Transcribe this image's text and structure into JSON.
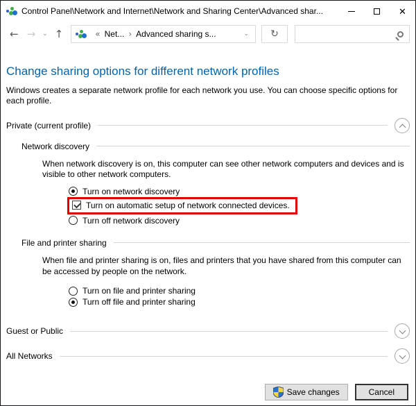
{
  "colors": {
    "heading": "#0063B1",
    "highlight": "#E00000"
  },
  "titlebar": {
    "title": "Control Panel\\Network and Internet\\Network and Sharing Center\\Advanced shar..."
  },
  "navbar": {
    "back": "←",
    "forward": "→",
    "history_dropdown": "⌄",
    "up": "↑",
    "crumb_overflow": "«",
    "crumb1": "Net...",
    "crumb_sep": "›",
    "crumb2": "Advanced sharing s...",
    "address_dropdown": "⌄",
    "refresh": "↻",
    "search_value": "",
    "search_placeholder": ""
  },
  "page": {
    "heading": "Change sharing options for different network profiles",
    "intro": "Windows creates a separate network profile for each network you use. You can choose specific options for each profile."
  },
  "private_section": {
    "label": "Private (current profile)",
    "expanded": true,
    "network_discovery": {
      "label": "Network discovery",
      "description": "When network discovery is on, this computer can see other network computers and devices and is visible to other network computers.",
      "turn_on": "Turn on network discovery",
      "turn_on_selected": true,
      "auto_setup": "Turn on automatic setup of network connected devices.",
      "auto_setup_checked": true,
      "turn_off": "Turn off network discovery",
      "turn_off_selected": false
    },
    "file_printer_sharing": {
      "label": "File and printer sharing",
      "description": "When file and printer sharing is on, files and printers that you have shared from this computer can be accessed by people on the network.",
      "turn_on": "Turn on file and printer sharing",
      "turn_on_selected": false,
      "turn_off": "Turn off file and printer sharing",
      "turn_off_selected": true
    }
  },
  "guest_section": {
    "label": "Guest or Public",
    "expanded": false
  },
  "all_networks_section": {
    "label": "All Networks",
    "expanded": false
  },
  "footer": {
    "save": "Save changes",
    "cancel": "Cancel"
  }
}
